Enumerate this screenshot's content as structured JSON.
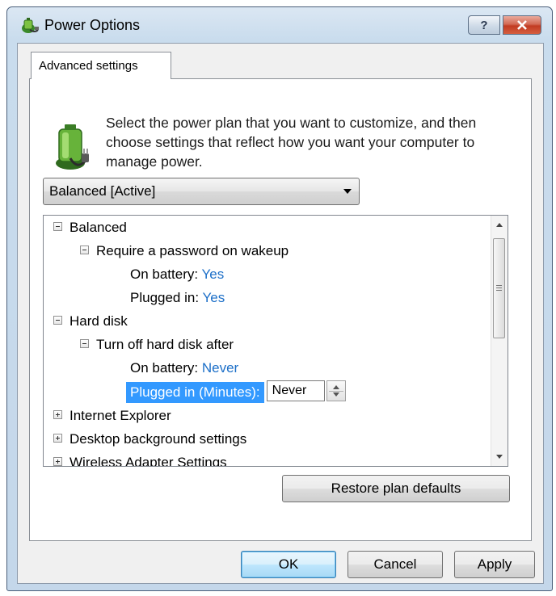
{
  "window": {
    "title": "Power Options"
  },
  "titlebar": {
    "help_label": "?"
  },
  "tab": {
    "label": "Advanced settings"
  },
  "intro_text": "Select the power plan that you want to customize, and then choose settings that reflect how you want your computer to manage power.",
  "plan_select": {
    "value": "Balanced [Active]"
  },
  "tree": {
    "balanced": {
      "label": "Balanced"
    },
    "require_password": {
      "label": "Require a password on wakeup"
    },
    "pw_battery": {
      "label": "On battery:",
      "value": "Yes"
    },
    "pw_plugged": {
      "label": "Plugged in:",
      "value": "Yes"
    },
    "hard_disk": {
      "label": "Hard disk"
    },
    "turn_off_hd": {
      "label": "Turn off hard disk after"
    },
    "hd_battery": {
      "label": "On battery:",
      "value": "Never"
    },
    "hd_plugged": {
      "label": "Plugged in (Minutes):",
      "value": "Never"
    },
    "internet_explorer": {
      "label": "Internet Explorer"
    },
    "desktop_background": {
      "label": "Desktop background settings"
    },
    "wireless_adapter": {
      "label": "Wireless Adapter Settings"
    }
  },
  "buttons": {
    "restore_label": "Restore plan defaults",
    "ok_label": "OK",
    "cancel_label": "Cancel",
    "apply_label": "Apply"
  },
  "colors": {
    "value_text": "#1c6fc8",
    "selection": "#3399ff",
    "close_button": "#c13b22"
  }
}
